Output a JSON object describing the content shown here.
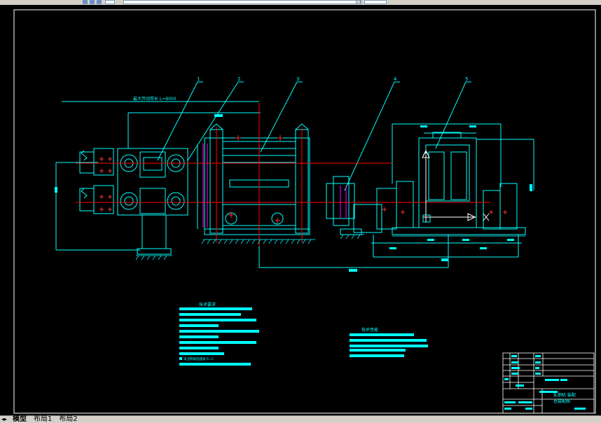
{
  "toolbar": {
    "icons": [
      "zoom-icon",
      "layer-icon",
      "properties-icon"
    ],
    "dropdown_value": "",
    "arrow_icon": "chevron-down-icon"
  },
  "layout_tabs": {
    "items": [
      "模型",
      "布局1",
      "布局2"
    ],
    "active": 0
  },
  "drawing": {
    "colors": {
      "background": "#000000",
      "line": "#00ffff",
      "axis": "#ff0000",
      "text": "#00ffff",
      "frame": "#ffffff",
      "bolt": "#ff3333",
      "magenta": "#ff00ff"
    },
    "callouts": [
      "1",
      "2",
      "3",
      "4",
      "5"
    ],
    "dimension_label": "最大传动带长 L=8000",
    "tech_requirements_title": "技术要求",
    "tech_requirements_note": "未注明铸造圆角 R=5",
    "tech_specs_title": "技术性能",
    "title_block": {
      "name_line1": "轧钢机 装配",
      "name_line2": "总装配图"
    }
  }
}
